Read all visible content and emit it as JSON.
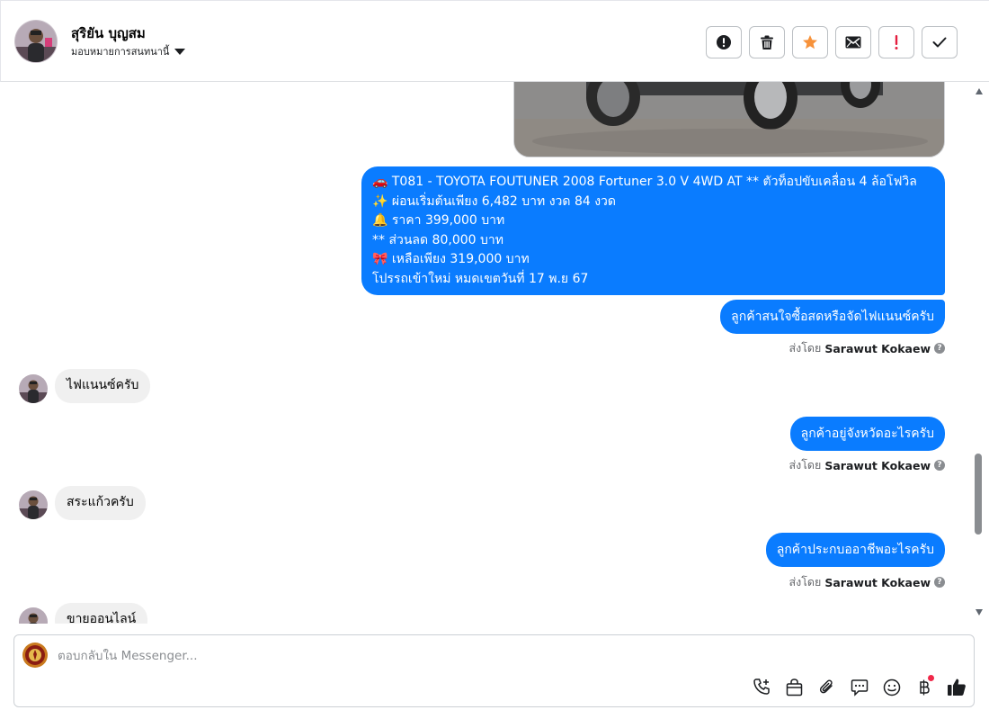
{
  "header": {
    "customer_name": "สุริยัน บุญสม",
    "assign_label": "มอบหมายการสนทนานี้",
    "actions": [
      {
        "name": "mark-spam-button",
        "icon": "alert-circle-icon"
      },
      {
        "name": "delete-button",
        "icon": "trash-icon"
      },
      {
        "name": "star-button",
        "icon": "star-icon"
      },
      {
        "name": "mark-unread-button",
        "icon": "envelope-icon"
      },
      {
        "name": "follow-up-button",
        "icon": "exclamation-icon"
      },
      {
        "name": "mark-done-button",
        "icon": "check-icon"
      }
    ]
  },
  "messages": {
    "listing": {
      "line1": "🚗 T081 - TOYOTA FOUTUNER 2008 Fortuner 3.0 V 4WD AT ** ตัวท็อปขับเคลื่อน 4 ล้อโฟวิล",
      "line2": "✨ ผ่อนเริ่มต้นเพียง 6,482 บาท งวด 84 งวด",
      "line3": "🔔 ราคา 399,000 บาท",
      "line4": "** ส่วนลด 80,000 บาท",
      "line5": "🎀 เหลือเพียง 319,000 บาท",
      "line6": "โปรรถเข้าใหม่ หมดเขตวันที่ 17 พ.ย 67"
    },
    "out1": "ลูกค้าสนใจซื้อสดหรือจัดไฟแนนซ์ครับ",
    "in1": "ไฟแนนซ์ครับ",
    "out2": "ลูกค้าอยู่จังหวัดอะไรครับ",
    "in2": "สระแก้วครับ",
    "out3": "ลูกค้าประกบออาชีพอะไรครับ",
    "in3": "ขายออนไลน์",
    "sent_by_prefix": "ส่งโดย",
    "sent_by_name": "Sarawut Kokaew"
  },
  "composer": {
    "placeholder": "ตอบกลับใน Messenger...",
    "tools": [
      "phone-plus-icon",
      "shopping-bag-icon",
      "paperclip-icon",
      "saved-reply-icon",
      "emoji-icon",
      "payment-baht-icon",
      "thumbs-up-icon"
    ]
  },
  "colors": {
    "outgoing_bubble": "#0a7cff",
    "incoming_bubble": "#f0f0f0",
    "star": "#f7923a",
    "follow_up": "#e41e3f"
  }
}
